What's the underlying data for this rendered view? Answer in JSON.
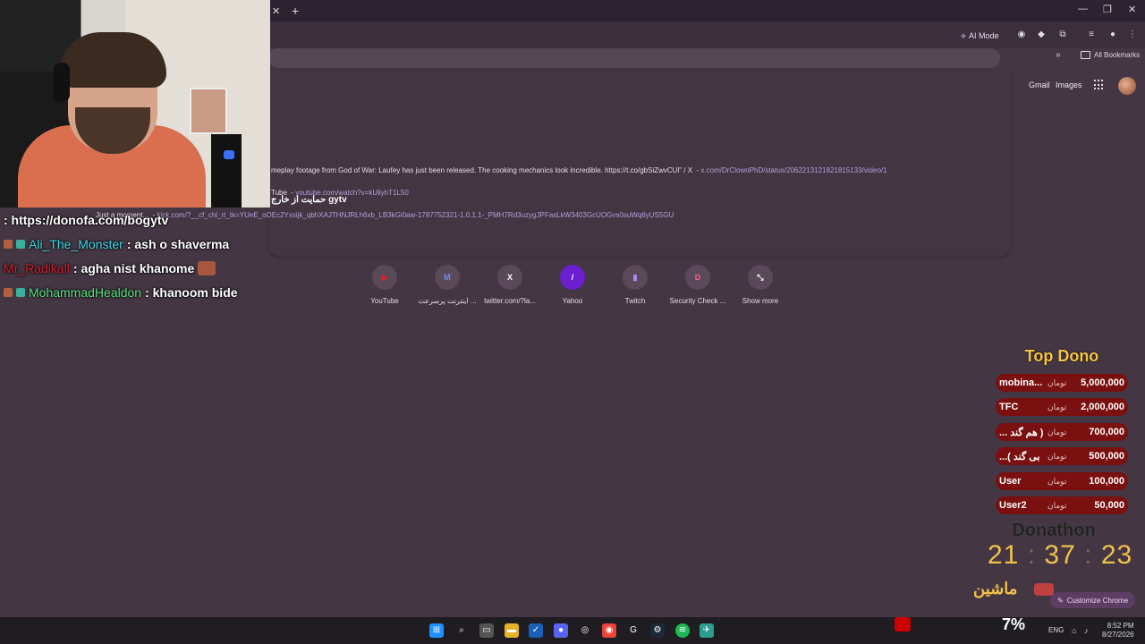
{
  "browser": {
    "ai_mode_label": "AI Mode",
    "all_bookmarks": "All Bookmarks",
    "gmail": "Gmail",
    "images": "Images",
    "customize_chrome": "Customize Chrome"
  },
  "suggestions": [
    {
      "text": "meplay footage from God of War: Laufey has just been released. The cooking mechanics look incredible. https://t.co/gbSiZwvCUl\" / X",
      "url": "x.com/DrClownPhD/status/2062213121821815133/video/1"
    },
    {
      "text": "Tube",
      "url": "youtube.com/watch?v=kUliyhT1L50"
    },
    {
      "text": "Just a moment...",
      "url": "kick.com/?__cf_chl_rt_tk=YUeE_oOEc2Yxsijk_qbhXAJTHNJRLh6xb_LB3kGi0aw-1787752321-1.0.1.1-_PMH7Rd3uzygJPFasLkW3403GcUOGvs0suWq6yUS5GU"
    }
  ],
  "persian_header": "حمایت از خارج gytv",
  "shortcuts": [
    {
      "label": "YouTube",
      "glyph": "▶",
      "color": "#e02020"
    },
    {
      "label": "اینترنت پرسرعت ...",
      "glyph": "M",
      "color": "#2040c0"
    },
    {
      "label": "twitter.com/?la...",
      "glyph": "X",
      "color": "#000000"
    },
    {
      "label": "Yahoo",
      "glyph": "/",
      "color": "#6a1fd0"
    },
    {
      "label": "Twitch",
      "glyph": "▮",
      "color": "#9146ff"
    },
    {
      "label": "Security Check ...",
      "glyph": "D",
      "color": "#a01030"
    },
    {
      "label": "Show more",
      "glyph": "⤡",
      "color": "#5a4a59"
    }
  ],
  "chat": {
    "donate_line": ": https://donofa.com/bogytv",
    "messages": [
      {
        "user": "Ali_The_Monster",
        "user_color": "#40d8e8",
        "text": ": ash o shaverma"
      },
      {
        "user": "Mr_Radikall",
        "user_color": "#d02030",
        "text": ": agha nist khanome"
      },
      {
        "user": "MohammadHealdon",
        "user_color": "#58e080",
        "text": ": khanoom bide"
      }
    ]
  },
  "top_dono": {
    "title": "Top Dono",
    "currency": "تومان",
    "rows": [
      {
        "name": "mobina...",
        "amount": "5,000,000"
      },
      {
        "name": "TFC",
        "amount": "2,000,000"
      },
      {
        "name": "... هم گند )",
        "amount": "700,000"
      },
      {
        "name": "...( بی گند",
        "amount": "500,000"
      },
      {
        "name": "User",
        "amount": "100,000"
      },
      {
        "name": "User2",
        "amount": "50,000"
      }
    ]
  },
  "donathon": {
    "title": "Donathon",
    "hours": "21",
    "minutes": "37",
    "seconds": "23",
    "sep": ":",
    "reward": "ماشین"
  },
  "taskbar": {
    "battery": "7%",
    "lang": "ENG",
    "time": "8:52 PM",
    "date": "8/27/2026"
  }
}
